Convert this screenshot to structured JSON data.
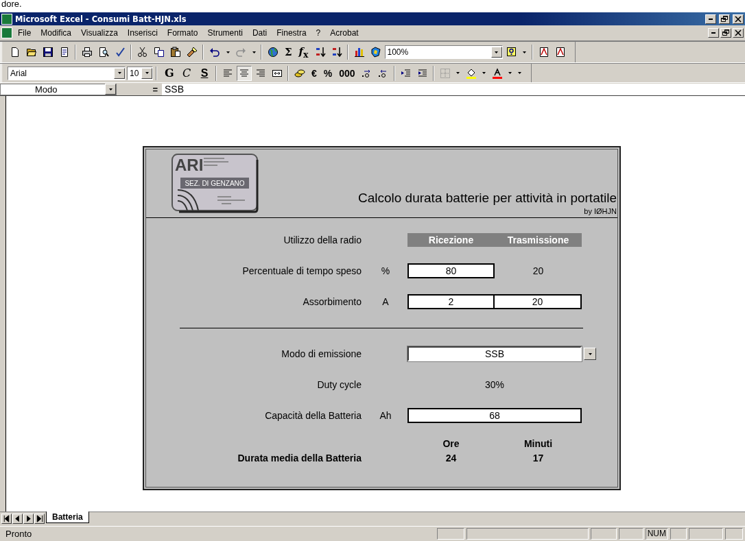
{
  "page_fragment": "dore.",
  "window": {
    "title": "Microsoft Excel - Consumi Batt-HJN.xls"
  },
  "menu": [
    "File",
    "Modifica",
    "Visualizza",
    "Inserisci",
    "Formato",
    "Strumenti",
    "Dati",
    "Finestra",
    "?",
    "Acrobat"
  ],
  "standard_toolbar": [
    [
      {
        "kind": "icon"
      },
      {
        "kind": "icon"
      },
      {
        "kind": "icon"
      },
      {
        "kind": "icon"
      }
    ],
    [
      {
        "kind": "icon"
      },
      {
        "kind": "icon"
      },
      {
        "kind": "icon"
      }
    ],
    [
      {
        "kind": "icon"
      },
      {
        "kind": "icon"
      },
      {
        "kind": "icon"
      },
      {
        "kind": "icon"
      }
    ],
    [
      {
        "kind": "icon"
      },
      {
        "kind": "icon"
      },
      {
        "kind": "icon"
      },
      {
        "kind": "icon"
      }
    ],
    [
      {
        "kind": "icon"
      },
      {
        "kind": "glyph",
        "text": "Σ"
      },
      {
        "kind": "glyph",
        "text": "*f*$_{x}$"
      },
      {
        "kind": "icon"
      },
      {
        "kind": "icon"
      }
    ],
    [
      {
        "kind": "icon"
      },
      {
        "kind": "icon"
      },
      {
        "kind": "combo",
        "value": "100%"
      },
      {
        "kind": "icon"
      },
      {
        "kind": "icon"
      }
    ],
    [
      {
        "kind": "icon"
      },
      {
        "kind": "icon"
      }
    ]
  ],
  "format_toolbar": [
    [
      {
        "kind": "combo",
        "value": "Arial"
      },
      {
        "kind": "combo",
        "value": "10"
      }
    ],
    [
      {
        "kind": "bold",
        "text": "G"
      },
      {
        "kind": "italic",
        "text": "C"
      },
      {
        "kind": "underline",
        "text": "S"
      }
    ],
    [
      {
        "kind": "icon",
        "selected": false
      },
      {
        "kind": "icon",
        "selected": true
      },
      {
        "kind": "icon",
        "selected": false
      },
      {
        "kind": "icon",
        "selected": false
      }
    ],
    [
      {
        "kind": "icon"
      },
      {
        "kind": "glyph",
        "text": "€"
      },
      {
        "kind": "glyph",
        "text": "%"
      },
      {
        "kind": "glyph",
        "text": "000"
      },
      {
        "kind": "icon"
      },
      {
        "kind": "icon"
      }
    ],
    [
      {
        "kind": "icon"
      },
      {
        "kind": "icon"
      }
    ],
    [
      {
        "kind": "icon"
      },
      {
        "kind": "icon"
      },
      {
        "kind": "icon"
      },
      {
        "kind": "icon"
      },
      {
        "kind": "icon"
      },
      {
        "kind": "icon"
      },
      {
        "kind": "icon"
      }
    ]
  ],
  "formula_bar": {
    "name_box": "Modo",
    "equals": "=",
    "value": "SSB"
  },
  "sheet": {
    "logo": {
      "letters": "ARI",
      "section": "SEZ. DI GENZANO"
    },
    "title": "Calcolo durata batterie per attività in portatile",
    "author": "by IØHJN",
    "rows": [
      {
        "kind": "columns",
        "label": "Utilizzo della radio",
        "columns": [
          "Ricezione",
          "Trasmissione"
        ]
      },
      {
        "kind": "cells",
        "label": "Percentuale di tempo speso",
        "unit": "%",
        "cells": [
          {
            "kind": "field",
            "value": "80"
          },
          {
            "kind": "text",
            "value": "20"
          }
        ]
      },
      {
        "kind": "cells",
        "label": "Assorbimento",
        "unit": "A",
        "cells": [
          {
            "kind": "field",
            "value": "2"
          },
          {
            "kind": "field",
            "value": "20"
          }
        ]
      },
      {
        "kind": "rule"
      },
      {
        "kind": "dropdown",
        "label": "Modo di emissione",
        "value": "SSB"
      },
      {
        "kind": "value",
        "label": "Duty cycle",
        "value": "30%"
      },
      {
        "kind": "wide_field",
        "label": "Capacità della Batteria",
        "unit": "Ah",
        "value": "68"
      }
    ],
    "result": {
      "label": "Durata media della Batteria",
      "columns": [
        {
          "heading": "Ore",
          "value": "24"
        },
        {
          "heading": "Minuti",
          "value": "17"
        }
      ]
    }
  },
  "sheet_tabs": [
    {
      "label": "Batteria",
      "selected": true
    }
  ],
  "status_bar": {
    "text": "Pronto",
    "indicators": [
      "NUM"
    ]
  }
}
